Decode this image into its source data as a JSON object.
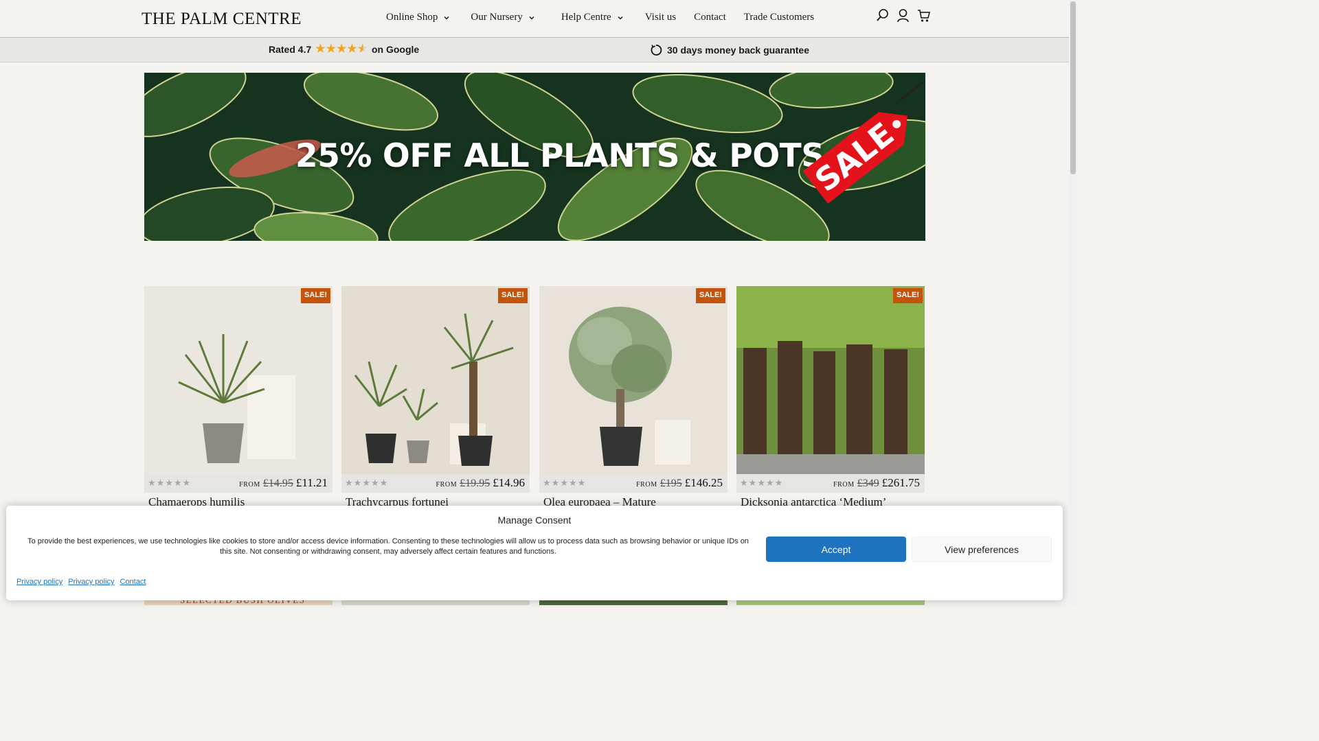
{
  "header": {
    "logo": "THE PALM CENTRE",
    "nav": [
      {
        "label": "Online Shop",
        "has_dropdown": true
      },
      {
        "label": "Our Nursery",
        "has_dropdown": true
      },
      {
        "label": "Help Centre",
        "has_dropdown": true
      },
      {
        "label": "Visit us",
        "has_dropdown": false
      },
      {
        "label": "Contact",
        "has_dropdown": false
      },
      {
        "label": "Trade Customers",
        "has_dropdown": false
      }
    ],
    "icons": [
      "search-icon",
      "account-icon",
      "cart-icon"
    ]
  },
  "infobar": {
    "rating_prefix": "Rated 4.7",
    "rating_value": 4.7,
    "rating_suffix": "on Google",
    "guarantee": "30 days money back guarantee"
  },
  "hero": {
    "title": "25% OFF ALL PLANTS & POTS",
    "tag": "SALE"
  },
  "products": [
    {
      "name": "Chamaerops humilis",
      "badge": "SALE!",
      "from": "FROM",
      "old_price": "£14.95",
      "price": "£11.21",
      "rating": 0
    },
    {
      "name": "Trachycarpus fortunei",
      "badge": "SALE!",
      "from": "FROM",
      "old_price": "£19.95",
      "price": "£14.96",
      "rating": 0
    },
    {
      "name": "Olea europaea – Mature",
      "badge": "SALE!",
      "from": "FROM",
      "old_price": "£195",
      "price": "£146.25",
      "rating": 0
    },
    {
      "name": "Dicksonia antarctica ‘Medium’",
      "badge": "SALE!",
      "from": "FROM",
      "old_price": "£349",
      "price": "£261.75",
      "rating": 0
    }
  ],
  "next_row": {
    "first_text": "SELECTED BUSH OLIVES"
  },
  "consent": {
    "title": "Manage Consent",
    "text": "To provide the best experiences, we use technologies like cookies to store and/or access device information. Consenting to these technologies will allow us to process data such as browsing behavior or unique IDs on this site. Not consenting or withdrawing consent, may adversely affect certain features and functions.",
    "accept": "Accept",
    "preferences": "View preferences",
    "links": [
      "Privacy policy",
      "Privacy policy",
      "Contact"
    ]
  },
  "colors": {
    "background": "#f4f3ef",
    "sale_badge": "#c4530b",
    "accept_button": "#1e73be",
    "star": "#f3a417"
  }
}
